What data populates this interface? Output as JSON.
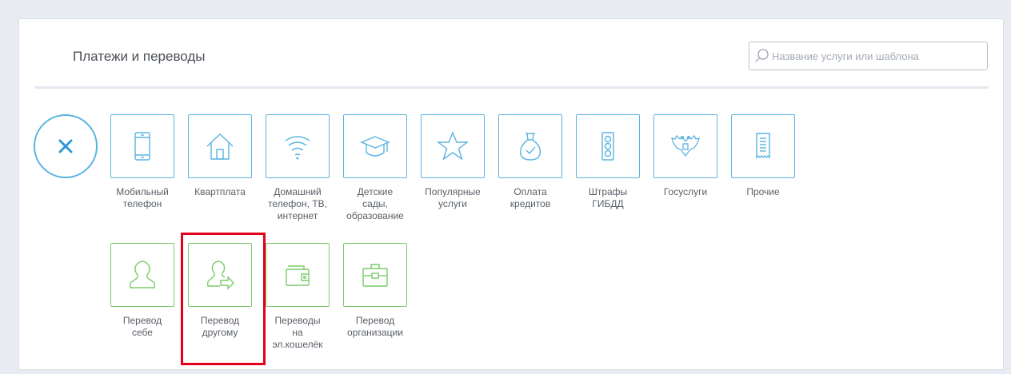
{
  "header": {
    "title": "Платежи и переводы",
    "search_placeholder": "Название услуги или шаблона"
  },
  "colors": {
    "accent_blue": "#5ab4e0",
    "accent_green": "#7ccb6a",
    "highlight_red": "#e3001b"
  },
  "categories": [
    {
      "label": "Мобильный\nтелефон",
      "icon": "mobile-phone-icon"
    },
    {
      "label": "Квартплата",
      "icon": "house-icon"
    },
    {
      "label": "Домашний\nтелефон, ТВ,\nинтернет",
      "icon": "wifi-icon"
    },
    {
      "label": "Детские\nсады,\nобразование",
      "icon": "graduation-cap-icon"
    },
    {
      "label": "Популярные\nуслуги",
      "icon": "star-icon"
    },
    {
      "label": "Оплата\nкредитов",
      "icon": "money-bag-icon"
    },
    {
      "label": "Штрафы\nГИБДД",
      "icon": "traffic-light-icon"
    },
    {
      "label": "Госуслуги",
      "icon": "eagle-emblem-icon"
    },
    {
      "label": "Прочие",
      "icon": "receipt-icon"
    }
  ],
  "transfers": [
    {
      "label": "Перевод\nсебе",
      "icon": "person-icon"
    },
    {
      "label": "Перевод\nдругому",
      "icon": "person-transfer-icon",
      "highlighted": true
    },
    {
      "label": "Переводы\nна\nэл.кошелёк",
      "icon": "wallet-icon"
    },
    {
      "label": "Перевод\nорганизации",
      "icon": "briefcase-icon"
    }
  ]
}
